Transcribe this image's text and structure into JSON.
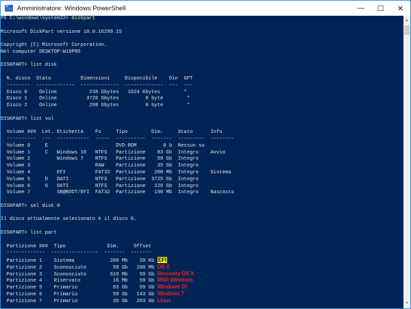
{
  "window": {
    "title": "Amministratore: Windows PowerShell",
    "minimize": "—",
    "maximize": "☐",
    "close": "✕"
  },
  "console": {
    "lines": [
      {
        "text": "PS C:\\windows\\system32> ",
        "cmd": "diskpart"
      },
      {
        "text": ""
      },
      {
        "text": "Microsoft DiskPart versione 10.0.16299.15"
      },
      {
        "text": ""
      },
      {
        "text": "Copyright (C) Microsoft Corporation."
      },
      {
        "text": "Nel computer DESKTOP-W10PRO"
      },
      {
        "text": ""
      },
      {
        "text": "DISKPART> list disk"
      },
      {
        "text": ""
      },
      {
        "text": "  N. disco  Stato          Dimensioni     Disponibile    Din  GPT"
      },
      {
        "text": "  --------  -------------  -------------  -------------  ---  ---"
      },
      {
        "text": "  Disco 0    Online           238 Gbytes   1024 Kbytes        *"
      },
      {
        "text": "  Disco 1    Online          3726 Gbytes         0 byte        *"
      },
      {
        "text": "  Disco 2    Online           298 Gbytes         0 byte        *"
      },
      {
        "text": ""
      },
      {
        "text": "DISKPART> list vol"
      },
      {
        "text": ""
      },
      {
        "text": "  Volume ###  Let. Etichetta    Fs     Tipo        Dim.     Stato      Info"
      },
      {
        "text": "  ----------  ---  -----------  -----  ----------  -------  ---------  --------"
      },
      {
        "text": "  Volume 0     E                       DVD-ROM         0 b  Nessun su"
      },
      {
        "text": "  Volume 1     C   Windows 10   NTFS   Partizione    83 Gb  Integro    Avvio"
      },
      {
        "text": "  Volume 2         Windows 7    NTFS   Partizione    59 Gb  Integro"
      },
      {
        "text": "  Volume 3                      RAW    Partizione    35 Gb  Integro"
      },
      {
        "text": "  Volume 4         EFI          FAT32  Partizione   200 Mb  Integro    Sistema"
      },
      {
        "text": "  Volume 5     D   DATI         NTFS   Partizione  3725 Gb  Integro"
      },
      {
        "text": "  Volume 6     G   DATI         NTFS   Partizione   226 Gb  Integro"
      },
      {
        "text": "  Volume 7         SB@BOOT/EFI  FAT32  Partizione   190 Mb  Integro    Nascosto"
      },
      {
        "text": ""
      },
      {
        "text": "DISKPART> sel disk 0"
      },
      {
        "text": ""
      },
      {
        "text": "Il disco attualmente selezionato è il disco 0."
      },
      {
        "text": ""
      },
      {
        "text": "DISKPART> list part"
      },
      {
        "text": ""
      },
      {
        "text": "  Partizione ###  Tipo              Dim.     Offset"
      },
      {
        "text": "  -------------  ----------------  -------  -------"
      },
      {
        "text": "  Partizione 1    Sistema            200 Mb    20 Kb ",
        "note": "EFI",
        "note_style": "yellow"
      },
      {
        "text": "  Partizione 2    Sconosciuto         59 Gb   200 Mb ",
        "note": "OS X",
        "note_style": "red"
      },
      {
        "text": "  Partizione 3    Sconosciuto        619 Mb    59 Gb ",
        "note": "Recovery OS X",
        "note_style": "red"
      },
      {
        "text": "  Partizione 4    Riservato           16 Mb    59 Gb ",
        "note": "MSR Windows",
        "note_style": "red"
      },
      {
        "text": "  Partizione 5    Primario            83 Gb    59 Gb ",
        "note": "Windows 10",
        "note_style": "red"
      },
      {
        "text": "  Partizione 6    Primario            59 Gb   143 Gb ",
        "note": "Windows 7",
        "note_style": "red"
      },
      {
        "text": "  Partizione 7    Primario            35 Gb   203 Gb ",
        "note": "Linux",
        "note_style": "red"
      }
    ]
  },
  "scrollbar": {
    "up": "▲",
    "down": "▼"
  },
  "colors": {
    "console_bg": "#012456",
    "command": "#f2f28a",
    "note_red": "#e8202a",
    "note_yellow": "#f5ee14"
  }
}
